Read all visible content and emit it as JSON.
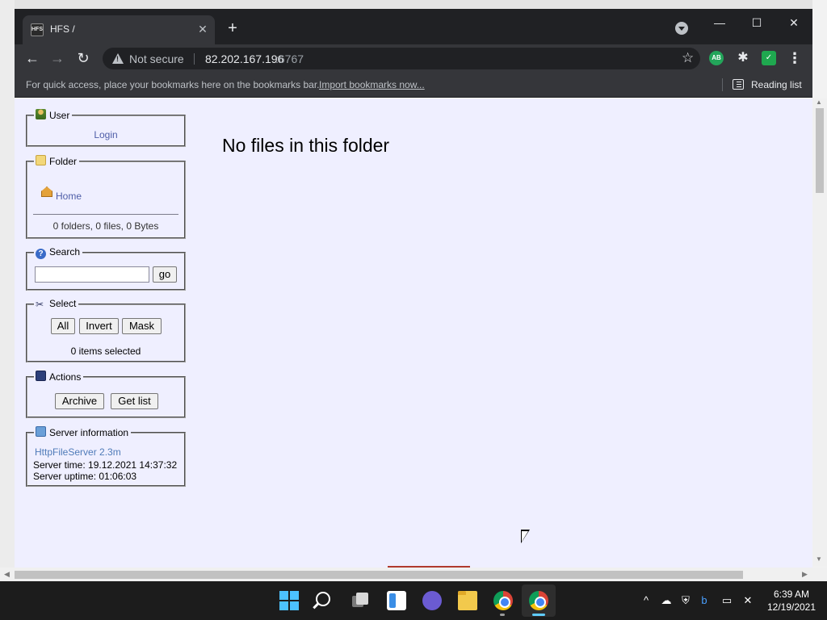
{
  "browser": {
    "tab_title": "HFS /",
    "tab_favicon_text": "HFS",
    "tab_close_glyph": "✕",
    "new_tab_glyph": "+",
    "window_controls": {
      "minimize": "—",
      "maximize": "☐",
      "close": "✕"
    },
    "nav": {
      "back": "←",
      "forward": "→",
      "reload": "↻"
    },
    "address": {
      "security_label": "Not secure",
      "host": "82.202.167.196",
      "port": ":6767",
      "bookmark_star": "☆"
    },
    "extensions": {
      "ab_label": "AB",
      "puzzle_glyph": "✱",
      "shield_glyph": "✓",
      "menu_glyph": "⋮"
    },
    "bookmarks_bar": {
      "hint": "For quick access, place your bookmarks here on the bookmarks bar.",
      "import_link": "Import bookmarks now...",
      "reading_list": "Reading list"
    }
  },
  "page": {
    "user_panel": {
      "legend": "User",
      "icon": "user-icon",
      "login_link": "Login"
    },
    "folder_panel": {
      "legend": "Folder",
      "icon": "folder-icon",
      "home_link": "Home",
      "stats": "0 folders, 0 files, 0 Bytes"
    },
    "search_panel": {
      "legend": "Search",
      "icon": "help-icon",
      "icon_glyph": "?",
      "input_value": "",
      "go_button": "go"
    },
    "select_panel": {
      "legend": "Select",
      "icon": "scissors-icon",
      "icon_glyph": "✂",
      "buttons": {
        "all": "All",
        "invert": "Invert",
        "mask": "Mask"
      },
      "status": "0 items selected"
    },
    "actions_panel": {
      "legend": "Actions",
      "icon": "disk-icon",
      "buttons": {
        "archive": "Archive",
        "get_list": "Get list"
      }
    },
    "server_panel": {
      "legend": "Server information",
      "icon": "server-icon",
      "software_link": "HttpFileServer 2.3m",
      "server_time": "Server time: 19.12.2021 14:37:32",
      "server_uptime": "Server uptime: 01:06:03"
    },
    "main_message": "No files in this folder"
  },
  "scrollbars": {
    "up": "▲",
    "down": "▼",
    "left": "◀",
    "right": "▶"
  },
  "taskbar": {
    "tray": {
      "chevron": "^",
      "cloud": "☁",
      "defender": "⛨",
      "bing": "b",
      "network": "▭",
      "volume": "✕"
    },
    "clock": {
      "time": "6:39 AM",
      "date": "12/19/2021"
    }
  }
}
